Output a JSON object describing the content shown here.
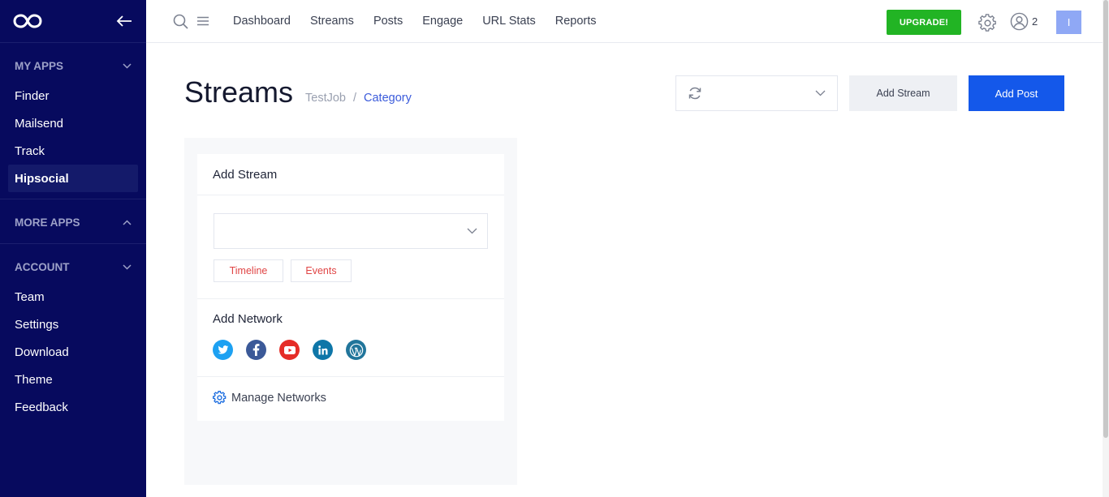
{
  "sidebar": {
    "sections": [
      {
        "title": "MY APPS",
        "items": [
          "Finder",
          "Mailsend",
          "Track",
          "Hipsocial"
        ],
        "active": "Hipsocial"
      },
      {
        "title": "MORE APPS",
        "items": []
      },
      {
        "title": "ACCOUNT",
        "items": [
          "Team",
          "Settings",
          "Download",
          "Theme",
          "Feedback"
        ]
      }
    ]
  },
  "topnav": {
    "links": [
      "Dashboard",
      "Streams",
      "Posts",
      "Engage",
      "URL Stats",
      "Reports"
    ],
    "upgrade_label": "UPGRADE!",
    "user_count": "2",
    "avatar_initial": "I"
  },
  "page": {
    "title": "Streams",
    "breadcrumb": {
      "root": "TestJob",
      "separator": "/",
      "current": "Category"
    },
    "add_stream_label": "Add Stream",
    "add_post_label": "Add Post"
  },
  "card": {
    "title": "Add Stream",
    "pills": [
      "Timeline",
      "Events"
    ],
    "network_title": "Add Network",
    "networks": [
      {
        "name": "twitter",
        "color": "#1da1f2"
      },
      {
        "name": "facebook",
        "color": "#3b5998"
      },
      {
        "name": "youtube",
        "color": "#e52d27"
      },
      {
        "name": "linkedin",
        "color": "#0e76a8"
      },
      {
        "name": "wordpress",
        "color": "#21759b"
      }
    ],
    "manage_label": "Manage Networks"
  },
  "colors": {
    "sidebar_bg": "#070a5e",
    "accent": "#1458ea",
    "upgrade": "#22b424"
  }
}
